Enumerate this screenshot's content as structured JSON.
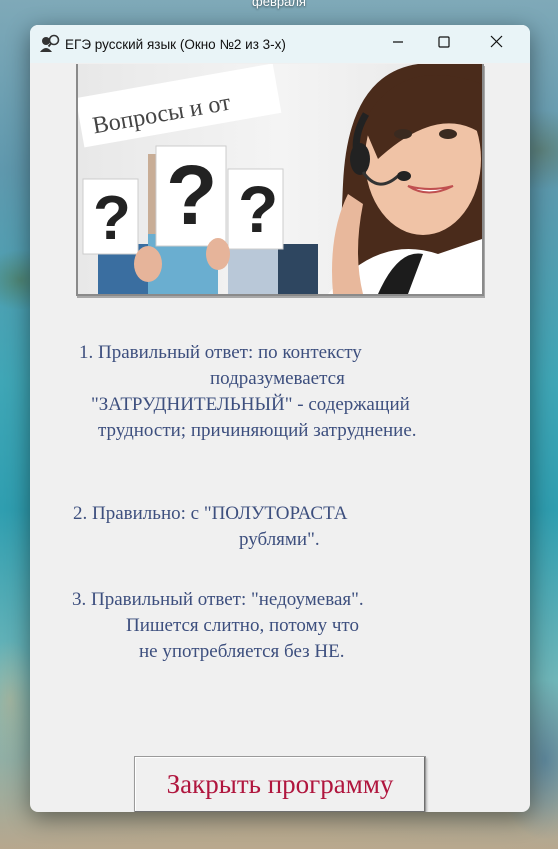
{
  "desktop": {
    "top_text": "февраля"
  },
  "window": {
    "title": "ЕГЭ русский язык (Окно №2 из 3-х)",
    "controls": {
      "minimize_icon": "minimize-icon",
      "maximize_icon": "maximize-icon",
      "close_icon": "close-icon"
    }
  },
  "banner": {
    "sign_text": "Вопросы и от",
    "question_marks": [
      "?",
      "?",
      "?"
    ]
  },
  "answers": {
    "a1": {
      "lines": [
        "1. Правильный ответ: по контексту",
        "подразумевается",
        "\"ЗАТРУДНИТЕЛЬНЫЙ\" - содержащий",
        "трудности; причиняющий затруднение."
      ]
    },
    "a2": {
      "lines": [
        "2. Правильно: с \"ПОЛУТОРАСТА",
        "рублями\"."
      ]
    },
    "a3": {
      "lines": [
        "3. Правильный ответ: \"недоумевая\".",
        "Пишется слитно, потому что",
        "не употребляется без НЕ."
      ]
    }
  },
  "buttons": {
    "close_program": "Закрыть программу"
  },
  "colors": {
    "answer_text": "#3d4f7e",
    "button_text": "#b0163e",
    "titlebar": "#e9f4f7"
  }
}
